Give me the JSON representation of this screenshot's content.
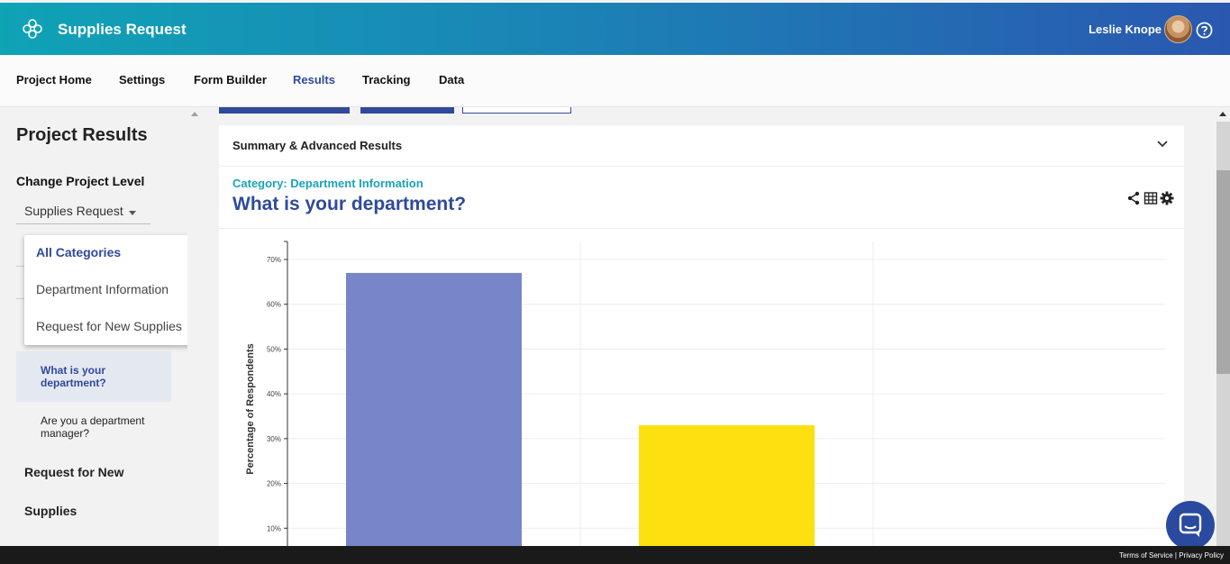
{
  "app": {
    "title": "Supplies Request",
    "user_name": "Leslie Knope"
  },
  "tabs": [
    {
      "label": "Project Home"
    },
    {
      "label": "Settings"
    },
    {
      "label": "Form Builder"
    },
    {
      "label": "Results",
      "active": true
    },
    {
      "label": "Tracking"
    },
    {
      "label": "Data"
    }
  ],
  "sidebar": {
    "title": "Project Results",
    "level_label": "Change Project Level",
    "level_value": "Supplies Request",
    "dropdown": [
      {
        "label": "All Categories",
        "selected": true
      },
      {
        "label": "Department Information"
      },
      {
        "label": "Request for New Supplies"
      }
    ],
    "questions": [
      {
        "label": "What is your department?",
        "active": true
      },
      {
        "label": "Are you a department manager?"
      }
    ],
    "category_lines": [
      "Request for New",
      "Supplies"
    ]
  },
  "main": {
    "section_title": "Summary & Advanced Results",
    "category": "Category: Department Information",
    "question": "What is your department?"
  },
  "footer": {
    "links": "Terms of Service | Privacy Policy"
  },
  "colors": {
    "primary": "#2f4a9c",
    "accent": "#1aa3b8",
    "bar1": "#7886c9",
    "bar2": "#fde010"
  },
  "chart_data": {
    "type": "bar",
    "categories": [
      "",
      ""
    ],
    "values": [
      67,
      33
    ],
    "ylabel": "Percentage of Respondents",
    "ylim": [
      0,
      72
    ],
    "yticks": [
      "10%",
      "20%",
      "30%",
      "40%",
      "50%",
      "60%",
      "70%"
    ],
    "colors": [
      "#7886c9",
      "#fde010"
    ],
    "grid": true
  }
}
